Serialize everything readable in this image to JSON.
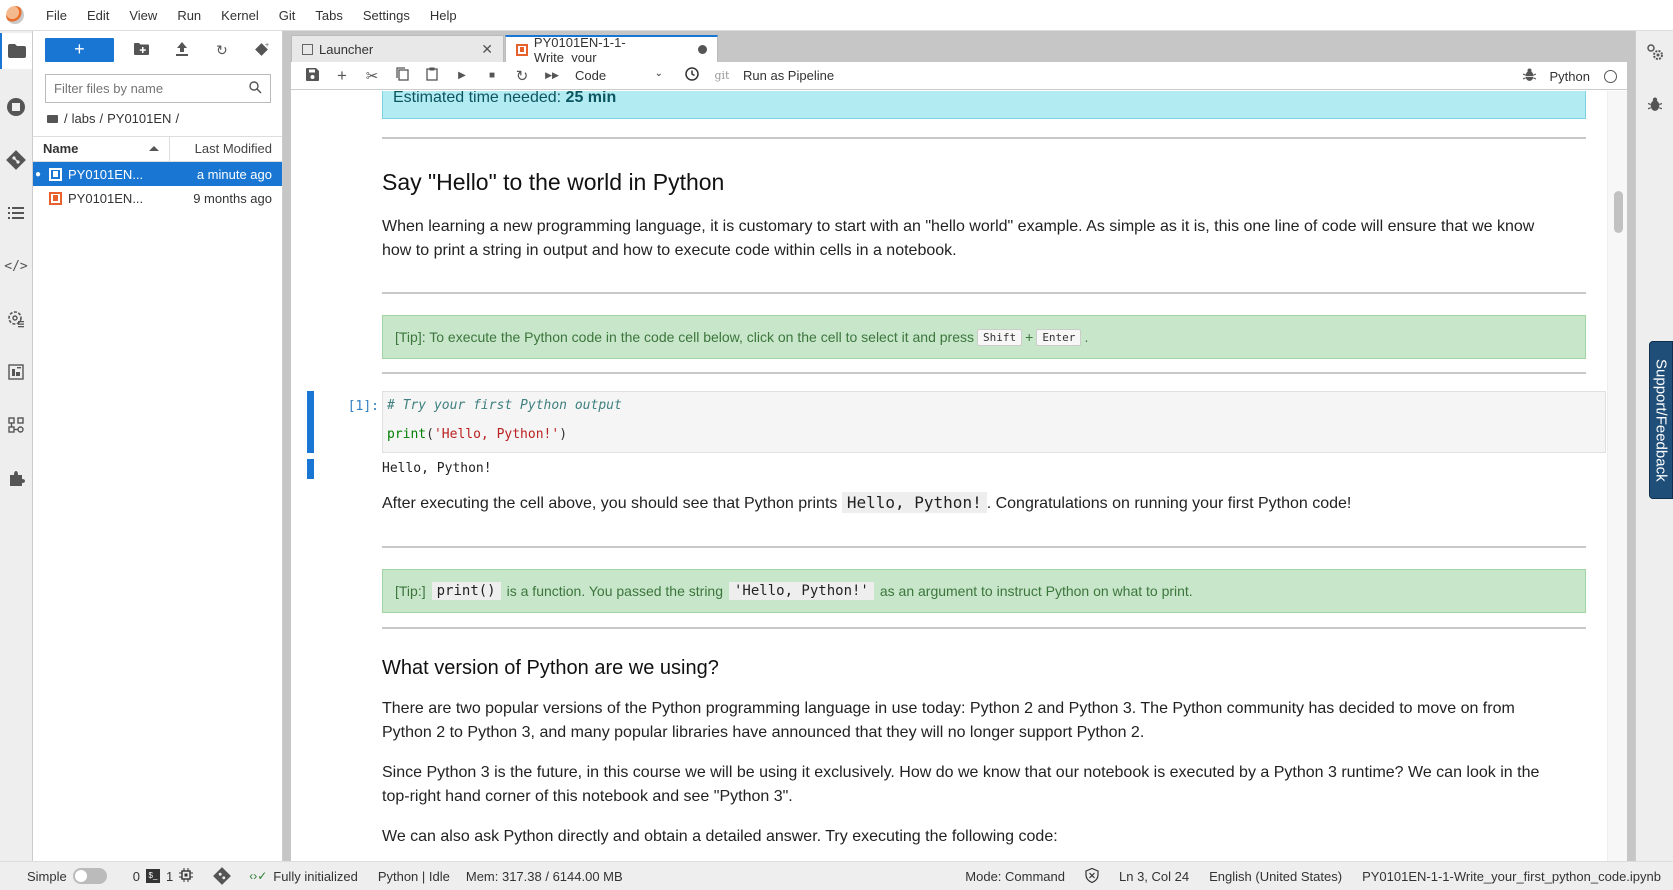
{
  "menubar": {
    "items": [
      "File",
      "Edit",
      "View",
      "Run",
      "Kernel",
      "Git",
      "Tabs",
      "Settings",
      "Help"
    ]
  },
  "leftbar": {
    "icons": [
      "folder-icon",
      "running-icon",
      "git-icon",
      "toc-icon",
      "code-snippets-icon",
      "extension-settings-icon",
      "property-inspector-icon",
      "components-icon",
      "extension-manager-icon"
    ]
  },
  "filebrowser": {
    "new_label": "+",
    "filter_placeholder": "Filter files by name",
    "breadcrumb": [
      "labs",
      "PY0101EN"
    ],
    "breadcrumb_root": "/",
    "columns": {
      "name": "Name",
      "modified": "Last Modified"
    },
    "files": [
      {
        "name": "PY0101EN...",
        "modified": "a minute ago",
        "selected": true,
        "running": true
      },
      {
        "name": "PY0101EN...",
        "modified": "9 months ago",
        "selected": false,
        "running": false
      }
    ]
  },
  "tabs": [
    {
      "label": "Launcher",
      "active": false
    },
    {
      "label": "PY0101EN-1-1-Write_your_",
      "active": true,
      "dirty": true
    }
  ],
  "toolbar": {
    "cell_type": "Code",
    "git_label": "git",
    "pipeline_label": "Run as Pipeline",
    "kernel_name": "Python"
  },
  "notebook": {
    "estimated_label": "Estimated time needed: ",
    "estimated_value": "25 min",
    "heading1": "Say \"Hello\" to the world in Python",
    "para1_line1": "When learning a new programming language, it is customary to start with an \"hello world\" example. As simple as it is, this one line of code will ensure that we know",
    "para1_line2": "how to print a string in output and how to execute code within cells in a notebook.",
    "tip1_text": "[Tip]: To execute the Python code in the code cell below, click on the cell to select it and press",
    "tip1_key1": "Shift",
    "tip1_plus": "+",
    "tip1_key2": "Enter",
    "tip1_end": ".",
    "cell_prompt": "[1]:",
    "code_comment": "# Try your first Python output",
    "code_fn": "print",
    "code_open": "(",
    "code_string": "'Hello, Python!'",
    "code_close": ")",
    "output_text": "Hello, Python!",
    "para2_before": "After executing the cell above, you should see that Python prints ",
    "para2_code": "Hello, Python!",
    "para2_after": ". Congratulations on running your first Python code!",
    "tip2_label": "[Tip:]",
    "tip2_code1": "print()",
    "tip2_mid": "is a function. You passed the string",
    "tip2_code2": "'Hello, Python!'",
    "tip2_end": "as an argument to instruct Python on what to print.",
    "heading2": "What version of Python are we using?",
    "para3_line1": "There are two popular versions of the Python programming language in use today: Python 2 and Python 3. The Python community has decided to move on from",
    "para3_line2": "Python 2 to Python 3, and many popular libraries have announced that they will no longer support Python 2.",
    "para4_line1": "Since Python 3 is the future, in this course we will be using it exclusively. How do we know that our notebook is executed by a Python 3 runtime? We can look in the",
    "para4_line2": "top-right hand corner of this notebook and see \"Python 3\".",
    "para5": "We can also ask Python directly and obtain a detailed answer. Try executing the following code:"
  },
  "rightbar": {
    "support_label": "Support/Feedback"
  },
  "statusbar": {
    "mode_label": "Simple",
    "terminals": "0",
    "kernels": "1",
    "lsp_status": "Fully initialized",
    "kernel_status": "Python | Idle",
    "memory": "Mem: 317.38 / 6144.00 MB",
    "command_mode": "Mode: Command",
    "cursor": "Ln 3, Col 24",
    "language": "English (United States)",
    "filename": "PY0101EN-1-1-Write_your_first_python_code.ipynb"
  }
}
